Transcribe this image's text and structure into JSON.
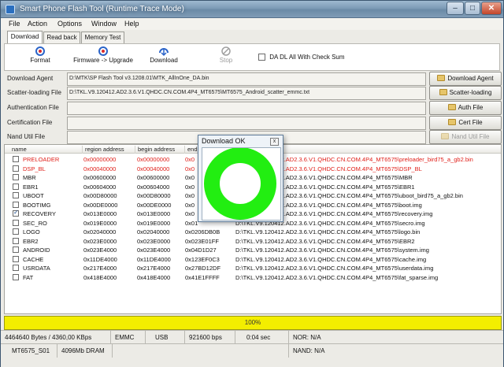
{
  "window": {
    "title": "Smart Phone Flash Tool (Runtime Trace Mode)",
    "controls": {
      "minimize": "–",
      "maximize": "□",
      "close": "✕"
    }
  },
  "menu": [
    "File",
    "Action",
    "Options",
    "Window",
    "Help"
  ],
  "tabs": [
    "Download",
    "Read back",
    "Memory Test"
  ],
  "toolbar": {
    "format": "Format",
    "firmware_upgrade": "Firmware -> Upgrade",
    "download": "Download",
    "stop": "Stop",
    "da_dl_label": "DA DL All With Check Sum",
    "da_dl_checked": false
  },
  "fields": {
    "download_agent": {
      "label": "Download Agent",
      "value": "D:\\MTK\\SP Flash Tool v3.1208.01\\MTK_AllInOne_DA.bin",
      "button": "Download Agent"
    },
    "scatter_loading": {
      "label": "Scatter-loading File",
      "value": "D:\\TKL.V9.120412.AD2.3.6.V1.QHDC.CN.COM.4P4_MT6575\\MT6575_Android_scatter_emmc.txt",
      "button": "Scatter-loading"
    },
    "authentication": {
      "label": "Authentication File",
      "value": "",
      "button": "Auth File"
    },
    "certification": {
      "label": "Certification File",
      "value": "",
      "button": "Cert File"
    },
    "nand_util": {
      "label": "Nand Util File",
      "value": "",
      "button": "Nand Util File"
    }
  },
  "table": {
    "headers": [
      "name",
      "region address",
      "begin address",
      "end"
    ],
    "rows": [
      {
        "name": "PRELOADER",
        "region": "0x00000000",
        "begin": "0x00000000",
        "end": "0x0",
        "path": "D:\\TKL.V9.120412.AD2.3.6.V1.QHDC.CN.COM.4P4_MT6575\\preloader_bird75_a_gb2.bin",
        "checked": false,
        "red": true
      },
      {
        "name": "DSP_BL",
        "region": "0x00040000",
        "begin": "0x00040000",
        "end": "0x0",
        "path": "D:\\TKL.V9.120412.AD2.3.6.V1.QHDC.CN.COM.4P4_MT6575\\DSP_BL",
        "checked": false,
        "red": true
      },
      {
        "name": "MBR",
        "region": "0x00600000",
        "begin": "0x00600000",
        "end": "0x0",
        "path": "D:\\TKL.V9.120412.AD2.3.6.V1.QHDC.CN.COM.4P4_MT6575\\MBR",
        "checked": false,
        "red": false
      },
      {
        "name": "EBR1",
        "region": "0x00604000",
        "begin": "0x00604000",
        "end": "0x0",
        "path": "D:\\TKL.V9.120412.AD2.3.6.V1.QHDC.CN.COM.4P4_MT6575\\EBR1",
        "checked": false,
        "red": false
      },
      {
        "name": "UBOOT",
        "region": "0x00D80000",
        "begin": "0x00D80000",
        "end": "0x0",
        "path": "D:\\TKL.V9.120412.AD2.3.6.V1.QHDC.CN.COM.4P4_MT6575\\uboot_bird75_a_gb2.bin",
        "checked": false,
        "red": false
      },
      {
        "name": "BOOTIMG",
        "region": "0x00DE0000",
        "begin": "0x00DE0000",
        "end": "0x0",
        "path": "D:\\TKL.V9.120412.AD2.3.6.V1.QHDC.CN.COM.4P4_MT6575\\boot.img",
        "checked": false,
        "red": false
      },
      {
        "name": "RECOVERY",
        "region": "0x013E0000",
        "begin": "0x013E0000",
        "end": "0x0",
        "path": "D:\\TKL.V9.120412.AD2.3.6.V1.QHDC.CN.COM.4P4_MT6575\\recovery.img",
        "checked": true,
        "red": false
      },
      {
        "name": "SEC_RO",
        "region": "0x019E0000",
        "begin": "0x019E0000",
        "end": "0x01",
        "path": "D:\\TKL.V9.120412.AD2.3.6.V1.QHDC.CN.COM.4P4_MT6575\\secro.img",
        "checked": false,
        "red": false
      },
      {
        "name": "LOGO",
        "region": "0x02040000",
        "begin": "0x02040000",
        "end": "0x0206DB0B",
        "path": "D:\\TKL.V9.120412.AD2.3.6.V1.QHDC.CN.COM.4P4_MT6575\\logo.bin",
        "checked": false,
        "red": false
      },
      {
        "name": "EBR2",
        "region": "0x023E0000",
        "begin": "0x023E0000",
        "end": "0x023E01FF",
        "path": "D:\\TKL.V9.120412.AD2.3.6.V1.QHDC.CN.COM.4P4_MT6575\\EBR2",
        "checked": false,
        "red": false
      },
      {
        "name": "ANDROID",
        "region": "0x023E4000",
        "begin": "0x023E4000",
        "end": "0x04D1D27",
        "path": "D:\\TKL.V9.120412.AD2.3.6.V1.QHDC.CN.COM.4P4_MT6575\\system.img",
        "checked": false,
        "red": false
      },
      {
        "name": "CACHE",
        "region": "0x11DE4000",
        "begin": "0x11DE4000",
        "end": "0x123EF0C3",
        "path": "D:\\TKL.V9.120412.AD2.3.6.V1.QHDC.CN.COM.4P4_MT6575\\cache.img",
        "checked": false,
        "red": false
      },
      {
        "name": "USRDATA",
        "region": "0x217E4000",
        "begin": "0x217E4000",
        "end": "0x27BD12DF",
        "path": "D:\\TKL.V9.120412.AD2.3.6.V1.QHDC.CN.COM.4P4_MT6575\\userdata.img",
        "checked": false,
        "red": false
      },
      {
        "name": "FAT",
        "region": "0x418E4000",
        "begin": "0x418E4000",
        "end": "0x41E1FFFF",
        "path": "D:\\TKL.V9.120412.AD2.3.6.V1.QHDC.CN.COM.4P4_MT6575\\fat_sparse.img",
        "checked": false,
        "red": false
      }
    ]
  },
  "progress": {
    "text": "100%",
    "fraction": 1.0,
    "color": "#f3ee00"
  },
  "status1": {
    "transfer": "4464640 Bytes / 4360,00 KBps",
    "storage": "EMMC",
    "port": "USB",
    "baud": "921600 bps",
    "time": "0:04 sec",
    "nor": "NOR: N/A"
  },
  "status2": {
    "chip": "MT6575_S01",
    "dram": "4096Mb DRAM",
    "nand": "NAND: N/A"
  },
  "dialog": {
    "title": "Download OK",
    "close": "x",
    "ring_color": "#22ee11"
  }
}
